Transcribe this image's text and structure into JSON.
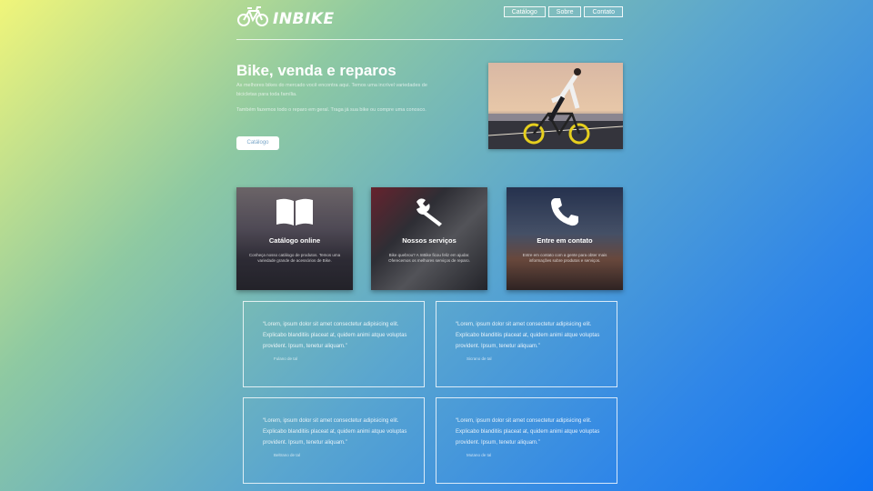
{
  "brand": {
    "name": "INBIKE",
    "logo_icon": "bicycle-icon"
  },
  "nav": {
    "items": [
      "Catálogo",
      "Sobre",
      "Contato"
    ]
  },
  "hero": {
    "title": "Bike, venda e reparos",
    "paragraph1": "As melhores bikes do mercado você encontra aqui. Temos uma incrível variedades de bicicletas para toda família.",
    "paragraph2": "Também fazemos todo o reparo em geral. Traga já sua bike ou compre uma conosco.",
    "button": "Catálogo"
  },
  "cards": [
    {
      "title": "Catálogo online",
      "desc": "Conheça nosso catálogo de produtos. Temos uma variedade grande de acessórios de Bike.",
      "icon": "book-icon"
    },
    {
      "title": "Nossos serviços",
      "desc": "Bike quebrou? A InBike ficou feliz em ajudar. Oferecemos os melhores serviços de reparo.",
      "icon": "wrench-icon"
    },
    {
      "title": "Entre em contato",
      "desc": "Entre em contato com a gente para obter mais informações sobre produtos e serviços.",
      "icon": "phone-icon"
    }
  ],
  "testimonials": [
    {
      "quote": "“Lorem, ipsum dolor sit amet consectetur adipisicing elit. Explicabo blanditiis placeat at, quidem animi atque voluptas provident. Ipsum, tenetur aliquam.”",
      "author": "Fulano de tal"
    },
    {
      "quote": "“Lorem, ipsum dolor sit amet consectetur adipisicing elit. Explicabo blanditiis placeat at, quidem animi atque voluptas provident. Ipsum, tenetur aliquam.”",
      "author": "Sicrano de tal"
    },
    {
      "quote": "“Lorem, ipsum dolor sit amet consectetur adipisicing elit. Explicabo blanditiis placeat at, quidem animi atque voluptas provident. Ipsum, tenetur aliquam.”",
      "author": "Beltrano de tal"
    },
    {
      "quote": "“Lorem, ipsum dolor sit amet consectetur adipisicing elit. Explicabo blanditiis placeat at, quidem animi atque voluptas provident. Ipsum, tenetur aliquam.”",
      "author": "Mutano de tal"
    }
  ]
}
